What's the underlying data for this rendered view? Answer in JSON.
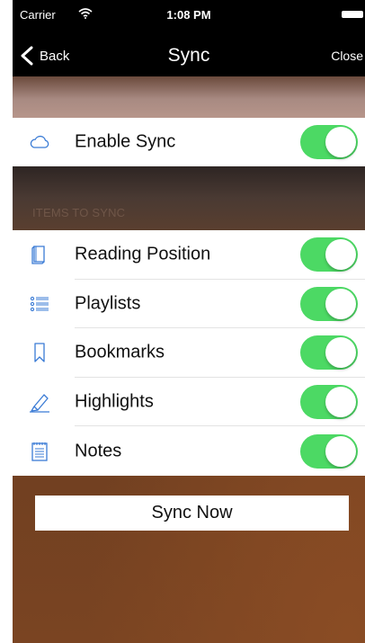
{
  "status_bar": {
    "carrier": "Carrier",
    "time": "1:08 PM",
    "icons": [
      "wifi-icon",
      "battery-icon"
    ]
  },
  "nav": {
    "back_label": "Back",
    "title": "Sync",
    "close_label": "Close"
  },
  "enable_sync": {
    "label": "Enable Sync",
    "icon": "cloud-icon",
    "enabled": true
  },
  "section": {
    "header": "ITEMS TO SYNC"
  },
  "items": [
    {
      "label": "Reading Position",
      "icon": "book-icon",
      "enabled": true
    },
    {
      "label": "Playlists",
      "icon": "list-icon",
      "enabled": true
    },
    {
      "label": "Bookmarks",
      "icon": "bookmark-icon",
      "enabled": true
    },
    {
      "label": "Highlights",
      "icon": "highlighter-icon",
      "enabled": true
    },
    {
      "label": "Notes",
      "icon": "notepad-icon",
      "enabled": true
    }
  ],
  "sync_now_label": "Sync Now",
  "colors": {
    "accent": "#3a7bd5",
    "toggle_on": "#4cd964",
    "nav_bg": "#000000"
  }
}
